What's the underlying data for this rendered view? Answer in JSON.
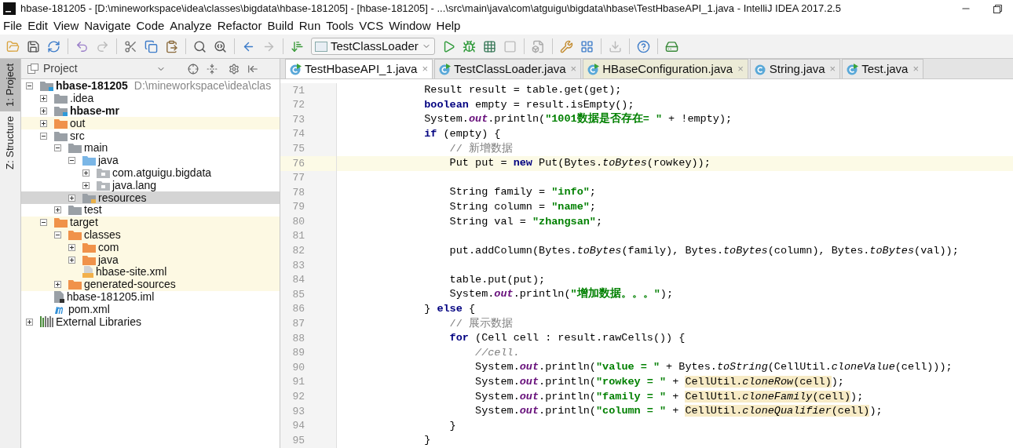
{
  "window": {
    "title": "hbase-181205 - [D:\\mineworkspace\\idea\\classes\\bigdata\\hbase-181205] - [hbase-181205] - ...\\src\\main\\java\\com\\atguigu\\bigdata\\hbase\\TestHbaseAPI_1.java - IntelliJ IDEA 2017.2.5"
  },
  "menu": [
    "File",
    "Edit",
    "View",
    "Navigate",
    "Code",
    "Analyze",
    "Refactor",
    "Build",
    "Run",
    "Tools",
    "VCS",
    "Window",
    "Help"
  ],
  "toolbar": {
    "run_configuration": "TestClassLoader"
  },
  "tool_strip": [
    {
      "label": "1: Project",
      "selected": true
    },
    {
      "label": "Z: Structure",
      "selected": false
    }
  ],
  "project_panel": {
    "title": "Project",
    "tree": [
      {
        "name": "hbase-181205",
        "path": "D:\\mineworkspace\\idea\\clas",
        "kind": "module",
        "bold": true,
        "expanded": true,
        "selected": false,
        "excluded": false,
        "children": [
          {
            "name": ".idea",
            "kind": "folder",
            "expanded": false,
            "selected": false,
            "excluded": false
          },
          {
            "name": "hbase-mr",
            "kind": "module",
            "bold": true,
            "expanded": false,
            "selected": false,
            "excluded": false
          },
          {
            "name": "out",
            "kind": "excluded-folder",
            "expanded": false,
            "selected": false,
            "excluded": true
          },
          {
            "name": "src",
            "kind": "folder",
            "expanded": true,
            "selected": false,
            "excluded": false,
            "children": [
              {
                "name": "main",
                "kind": "folder",
                "expanded": true,
                "selected": false,
                "excluded": false,
                "children": [
                  {
                    "name": "java",
                    "kind": "source-folder",
                    "expanded": true,
                    "selected": false,
                    "excluded": false,
                    "children": [
                      {
                        "name": "com.atguigu.bigdata",
                        "kind": "package",
                        "expanded": false,
                        "selected": false,
                        "excluded": false
                      },
                      {
                        "name": "java.lang",
                        "kind": "package",
                        "expanded": false,
                        "selected": false,
                        "excluded": false
                      }
                    ]
                  },
                  {
                    "name": "resources",
                    "kind": "resources-folder",
                    "expanded": false,
                    "selected": true,
                    "excluded": false
                  }
                ]
              },
              {
                "name": "test",
                "kind": "folder",
                "expanded": false,
                "selected": false,
                "excluded": false
              }
            ]
          },
          {
            "name": "target",
            "kind": "excluded-folder",
            "expanded": true,
            "selected": false,
            "excluded": true,
            "children": [
              {
                "name": "classes",
                "kind": "excluded-folder",
                "expanded": true,
                "selected": false,
                "excluded": true,
                "children": [
                  {
                    "name": "com",
                    "kind": "excluded-folder",
                    "expanded": false,
                    "selected": false,
                    "excluded": true
                  },
                  {
                    "name": "java",
                    "kind": "excluded-folder",
                    "expanded": false,
                    "selected": false,
                    "excluded": true
                  },
                  {
                    "name": "hbase-site.xml",
                    "kind": "xml",
                    "selected": false,
                    "excluded": true
                  }
                ]
              },
              {
                "name": "generated-sources",
                "kind": "excluded-folder",
                "expanded": false,
                "selected": false,
                "excluded": true
              }
            ]
          },
          {
            "name": "hbase-181205.iml",
            "kind": "iml",
            "selected": false,
            "excluded": false
          },
          {
            "name": "pom.xml",
            "kind": "maven",
            "selected": false,
            "excluded": false
          }
        ]
      },
      {
        "name": "External Libraries",
        "kind": "libraries",
        "expanded": false,
        "selected": false,
        "excluded": false
      }
    ]
  },
  "tabs": [
    {
      "label": "TestHbaseAPI_1.java",
      "kind": "runnable-class",
      "library": false,
      "selected": true,
      "close": "×"
    },
    {
      "label": "TestClassLoader.java",
      "kind": "runnable-class",
      "library": false,
      "selected": false,
      "close": "×"
    },
    {
      "label": "HBaseConfiguration.java",
      "kind": "runnable-class",
      "library": true,
      "selected": false,
      "close": "×"
    },
    {
      "label": "String.java",
      "kind": "class",
      "library": false,
      "selected": false,
      "close": "×"
    },
    {
      "label": "Test.java",
      "kind": "runnable-class",
      "library": false,
      "selected": false,
      "close": "×"
    }
  ],
  "editor": {
    "lines": [
      {
        "number": "71",
        "current": false,
        "tokens": [
          {
            "kind": "plain",
            "text": "            Result result = table.get(get);"
          }
        ]
      },
      {
        "number": "72",
        "current": false,
        "tokens": [
          {
            "kind": "keyword",
            "text": "            boolean"
          },
          {
            "kind": "plain",
            "text": " empty = result.isEmpty();"
          }
        ]
      },
      {
        "number": "73",
        "current": false,
        "tokens": [
          {
            "kind": "plain",
            "text": "            System."
          },
          {
            "kind": "field",
            "text": "out"
          },
          {
            "kind": "plain",
            "text": ".println("
          },
          {
            "kind": "string",
            "text": "\"1001数据是否存在= \""
          },
          {
            "kind": "plain",
            "text": " + !empty);"
          }
        ]
      },
      {
        "number": "74",
        "current": false,
        "tokens": [
          {
            "kind": "keyword",
            "text": "            if"
          },
          {
            "kind": "plain",
            "text": " (empty) {"
          }
        ]
      },
      {
        "number": "75",
        "current": false,
        "tokens": [
          {
            "kind": "comment",
            "text": "                // 新增数据"
          }
        ]
      },
      {
        "number": "76",
        "current": true,
        "tokens": [
          {
            "kind": "plain",
            "text": "                Put put = "
          },
          {
            "kind": "keyword",
            "text": "new"
          },
          {
            "kind": "plain",
            "text": " Put(Bytes."
          },
          {
            "kind": "static",
            "text": "toBytes"
          },
          {
            "kind": "plain",
            "text": "(rowkey));"
          }
        ]
      },
      {
        "number": "77",
        "current": false
      },
      {
        "number": "78",
        "current": false,
        "tokens": [
          {
            "kind": "plain",
            "text": "                String family = "
          },
          {
            "kind": "string",
            "text": "\"info\""
          },
          {
            "kind": "plain",
            "text": ";"
          }
        ]
      },
      {
        "number": "79",
        "current": false,
        "tokens": [
          {
            "kind": "plain",
            "text": "                String column = "
          },
          {
            "kind": "string",
            "text": "\"name\""
          },
          {
            "kind": "plain",
            "text": ";"
          }
        ]
      },
      {
        "number": "80",
        "current": false,
        "tokens": [
          {
            "kind": "plain",
            "text": "                String val = "
          },
          {
            "kind": "string",
            "text": "\"zhangsan\""
          },
          {
            "kind": "plain",
            "text": ";"
          }
        ]
      },
      {
        "number": "81",
        "current": false
      },
      {
        "number": "82",
        "current": false,
        "tokens": [
          {
            "kind": "plain",
            "text": "                put.addColumn(Bytes."
          },
          {
            "kind": "static",
            "text": "toBytes"
          },
          {
            "kind": "plain",
            "text": "(family), Bytes."
          },
          {
            "kind": "static",
            "text": "toBytes"
          },
          {
            "kind": "plain",
            "text": "(column), Bytes."
          },
          {
            "kind": "static",
            "text": "toBytes"
          },
          {
            "kind": "plain",
            "text": "(val));"
          }
        ]
      },
      {
        "number": "83",
        "current": false
      },
      {
        "number": "84",
        "current": false,
        "tokens": [
          {
            "kind": "plain",
            "text": "                table.put(put);"
          }
        ]
      },
      {
        "number": "85",
        "current": false,
        "tokens": [
          {
            "kind": "plain",
            "text": "                System."
          },
          {
            "kind": "field",
            "text": "out"
          },
          {
            "kind": "plain",
            "text": ".println("
          },
          {
            "kind": "string",
            "text": "\"增加数据。。。\""
          },
          {
            "kind": "plain",
            "text": ");"
          }
        ]
      },
      {
        "number": "86",
        "current": false,
        "tokens": [
          {
            "kind": "plain",
            "text": "            } "
          },
          {
            "kind": "keyword",
            "text": "else"
          },
          {
            "kind": "plain",
            "text": " {"
          }
        ]
      },
      {
        "number": "87",
        "current": false,
        "tokens": [
          {
            "kind": "comment",
            "text": "                // 展示数据"
          }
        ]
      },
      {
        "number": "88",
        "current": false,
        "tokens": [
          {
            "kind": "keyword",
            "text": "                for"
          },
          {
            "kind": "plain",
            "text": " (Cell cell : result.rawCells()) {"
          }
        ]
      },
      {
        "number": "89",
        "current": false,
        "tokens": [
          {
            "kind": "italic-comment",
            "text": "                    //cell."
          }
        ]
      },
      {
        "number": "90",
        "current": false,
        "tokens": [
          {
            "kind": "plain",
            "text": "                    System."
          },
          {
            "kind": "field",
            "text": "out"
          },
          {
            "kind": "plain",
            "text": ".println("
          },
          {
            "kind": "string",
            "text": "\"value = \""
          },
          {
            "kind": "plain",
            "text": " + Bytes."
          },
          {
            "kind": "static",
            "text": "toString"
          },
          {
            "kind": "plain",
            "text": "(CellUtil."
          },
          {
            "kind": "static",
            "text": "cloneValue"
          },
          {
            "kind": "plain",
            "text": "(cell)));"
          }
        ]
      },
      {
        "number": "91",
        "current": false,
        "tokens": [
          {
            "kind": "plain",
            "text": "                    System."
          },
          {
            "kind": "field",
            "text": "out"
          },
          {
            "kind": "plain",
            "text": ".println("
          },
          {
            "kind": "string",
            "text": "\"rowkey = \""
          },
          {
            "kind": "plain",
            "text": " + "
          },
          {
            "kind": "marked",
            "text": "CellUtil."
          },
          {
            "kind": "marked-static",
            "text": "cloneRow"
          },
          {
            "kind": "marked",
            "text": "(cell)"
          },
          {
            "kind": "plain",
            "text": ");"
          }
        ]
      },
      {
        "number": "92",
        "current": false,
        "tokens": [
          {
            "kind": "plain",
            "text": "                    System."
          },
          {
            "kind": "field",
            "text": "out"
          },
          {
            "kind": "plain",
            "text": ".println("
          },
          {
            "kind": "string",
            "text": "\"family = \""
          },
          {
            "kind": "plain",
            "text": " + "
          },
          {
            "kind": "marked",
            "text": "CellUtil."
          },
          {
            "kind": "marked-static",
            "text": "cloneFamily"
          },
          {
            "kind": "marked",
            "text": "(cell)"
          },
          {
            "kind": "plain",
            "text": ");"
          }
        ]
      },
      {
        "number": "93",
        "current": false,
        "tokens": [
          {
            "kind": "plain",
            "text": "                    System."
          },
          {
            "kind": "field",
            "text": "out"
          },
          {
            "kind": "plain",
            "text": ".println("
          },
          {
            "kind": "string",
            "text": "\"column = \""
          },
          {
            "kind": "plain",
            "text": " + "
          },
          {
            "kind": "marked",
            "text": "CellUtil."
          },
          {
            "kind": "marked-static",
            "text": "cloneQualifier"
          },
          {
            "kind": "marked",
            "text": "(cell)"
          },
          {
            "kind": "plain",
            "text": ");"
          }
        ]
      },
      {
        "number": "94",
        "current": false,
        "tokens": [
          {
            "kind": "plain",
            "text": "                }"
          }
        ]
      },
      {
        "number": "95",
        "current": false,
        "tokens": [
          {
            "kind": "plain",
            "text": "            }"
          }
        ]
      }
    ]
  }
}
